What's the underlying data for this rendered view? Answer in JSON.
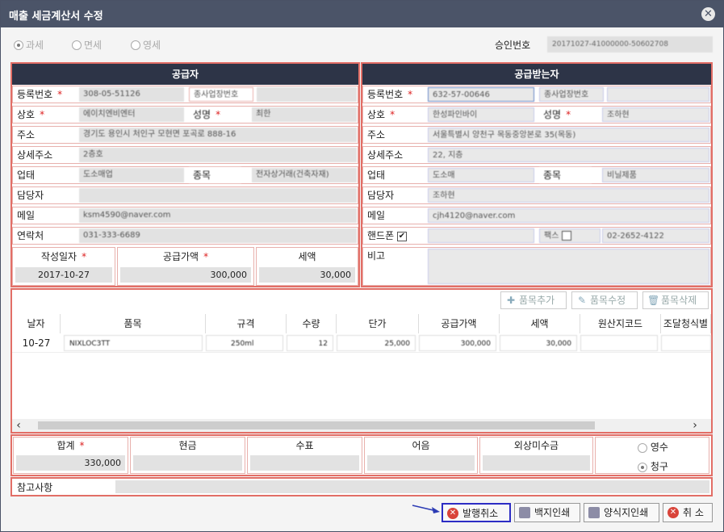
{
  "window": {
    "title": "매출 세금계산서 수정",
    "close_icon": "✕"
  },
  "tax_type": {
    "options": [
      "과세",
      "면세",
      "영세"
    ],
    "selected": "과세"
  },
  "approval": {
    "label": "승인번호",
    "value": "20171027-41000000-50602708"
  },
  "supplier": {
    "header": "공급자",
    "reg_label": "등록번호",
    "reg_value": "308-05-51126",
    "sub_reg_label": "종사업장번호",
    "name_label": "상호",
    "name_value": "에이치엔비엔터",
    "rep_label": "성명",
    "rep_value": "최한",
    "addr_label": "주소",
    "addr_value": "경기도 용인시 처인구 모현면 포곡로 888-16",
    "addr2_label": "상세주소",
    "addr2_value": "2층호",
    "biz_label": "업태",
    "biz_value": "도소매업",
    "item_label": "종목",
    "item_value": "전자상거래(건축자재)",
    "mgr_label": "담당자",
    "mgr_value": "",
    "mail_label": "메일",
    "mail_value": "ksm4590@naver.com",
    "tel_label": "연락처",
    "tel_value": "031-333-6689"
  },
  "buyer": {
    "header": "공급받는자",
    "reg_label": "등록번호",
    "reg_value": "632-57-00646",
    "sub_reg_label": "종사업장번호",
    "name_label": "상호",
    "name_value": "한성파인바이",
    "rep_label": "성명",
    "rep_value": "조하현",
    "addr_label": "주소",
    "addr_value": "서울특별시 양천구 목동중앙본로 35(목동)",
    "addr2_label": "상세주소",
    "addr2_value": "22, 지층",
    "biz_label": "업태",
    "biz_value": "도소매",
    "item_label": "종목",
    "item_value": "비닐제품",
    "mgr_label": "담당자",
    "mgr_value": "조하현",
    "mail_label": "메일",
    "mail_value": "cjh4120@naver.com",
    "phone_label": "핸드폰",
    "phone_value": "",
    "fax_label": "팩스",
    "fax_value": "02-2652-4122",
    "memo_label": "비고"
  },
  "summary": {
    "date_label": "작성일자",
    "date_value": "2017-10-27",
    "supply_label": "공급가액",
    "supply_value": "300,000",
    "tax_label": "세액",
    "tax_value": "30,000"
  },
  "toolbar": {
    "add": "품목추가",
    "edit": "품목수정",
    "delete": "품목삭제"
  },
  "grid": {
    "columns": [
      "날자",
      "품목",
      "규격",
      "수량",
      "단가",
      "공급가액",
      "세액",
      "원산지코드",
      "조달청식별"
    ],
    "rows": [
      [
        "10-27",
        "NIXLOC3TT",
        "250ml",
        "12",
        "25,000",
        "300,000",
        "30,000",
        "",
        ""
      ]
    ]
  },
  "totals": {
    "total_label": "합계",
    "total_value": "330,000",
    "cash_label": "현금",
    "check_label": "수표",
    "note_label": "어음",
    "credit_label": "외상미수금",
    "receipt_options": [
      "영수",
      "청구"
    ],
    "receipt_selected": "청구"
  },
  "reference": {
    "label": "참고사항"
  },
  "buttons": {
    "cancel_issue": "발행취소",
    "print_blank": "백지인쇄",
    "print_form": "양식지인쇄",
    "cancel": "취 소"
  }
}
